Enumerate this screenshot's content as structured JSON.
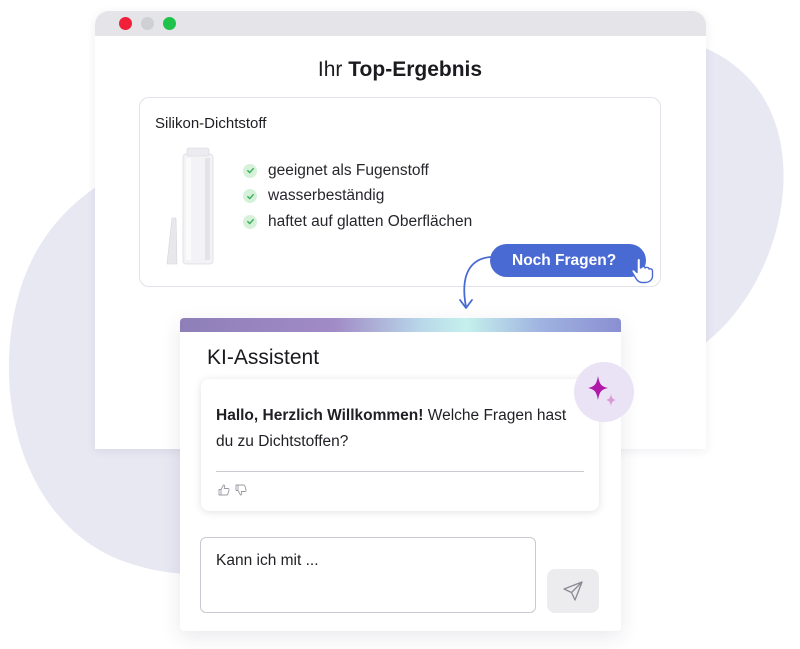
{
  "colors": {
    "accent": "#4a6ad3",
    "sparkle": "#b018a8",
    "check": "#3fae55",
    "background_blob": "#e8e8f3"
  },
  "results": {
    "title_light": "Ihr",
    "title_bold": "Top-Ergebnis",
    "product_name": "Silikon-Dichtstoff",
    "features": [
      "geeignet als Fugenstoff",
      "wasserbeständig",
      "haftet auf glatten Oberflächen"
    ],
    "cta_label": "Noch Fragen?"
  },
  "assistant": {
    "title": "KI-Assistent",
    "greeting_bold": "Hallo, Herzlich Willkommen!",
    "greeting_rest": " Welche Fragen hast du zu Dichtstoffen?",
    "input_value": "Kann ich mit ...",
    "icons": {
      "avatar": "sparkle-icon",
      "feedback_up": "thumbs-up-icon",
      "feedback_down": "thumbs-down-icon",
      "send": "send-icon"
    }
  }
}
